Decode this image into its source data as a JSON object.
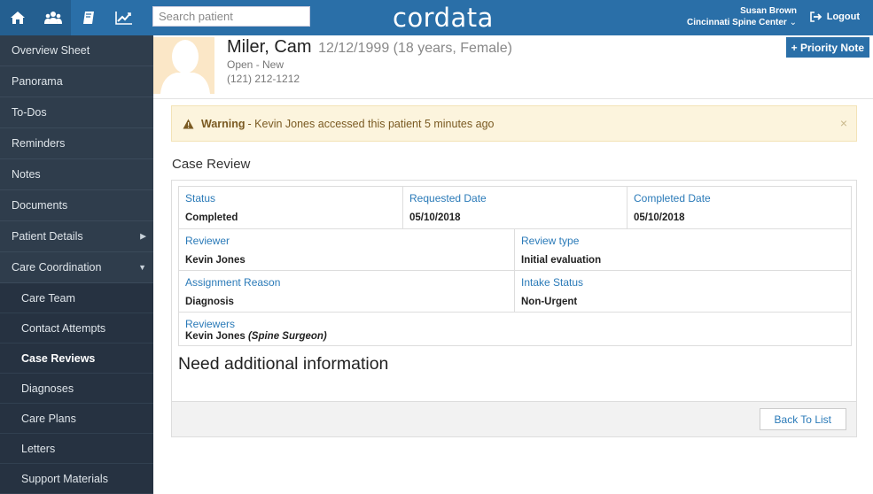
{
  "topbar": {
    "nav_icons": [
      "home-icon",
      "team-icon",
      "book-icon",
      "chart-icon"
    ],
    "search_placeholder": "Search patient",
    "brand": "cordata",
    "user_name": "Susan Brown",
    "org_name": "Cincinnati Spine Center",
    "logout_label": "Logout"
  },
  "sidebar": {
    "items": [
      {
        "label": "Overview Sheet"
      },
      {
        "label": "Panorama"
      },
      {
        "label": "To-Dos"
      },
      {
        "label": "Reminders"
      },
      {
        "label": "Notes"
      },
      {
        "label": "Documents"
      },
      {
        "label": "Patient Details"
      },
      {
        "label": "Care Coordination"
      }
    ],
    "sub_items": [
      {
        "label": "Care Team"
      },
      {
        "label": "Contact Attempts"
      },
      {
        "label": "Case Reviews"
      },
      {
        "label": "Diagnoses"
      },
      {
        "label": "Care Plans"
      },
      {
        "label": "Letters"
      },
      {
        "label": "Support Materials"
      }
    ]
  },
  "patient": {
    "name": "Miler, Cam",
    "dob_info": "12/12/1999 (18 years, Female)",
    "status": "Open - New",
    "phone": "(121) 212-1212",
    "priority_note_label": "+ Priority Note"
  },
  "warning": {
    "title": "Warning",
    "message": "- Kevin Jones accessed this patient 5 minutes ago"
  },
  "case_review": {
    "title": "Case Review",
    "status_label": "Status",
    "status_value": "Completed",
    "requested_label": "Requested Date",
    "requested_value": "05/10/2018",
    "completed_label": "Completed Date",
    "completed_value": "05/10/2018",
    "reviewer_label": "Reviewer",
    "reviewer_value": "Kevin Jones",
    "review_type_label": "Review type",
    "review_type_value": "Initial evaluation",
    "assignment_label": "Assignment Reason",
    "assignment_value": "Diagnosis",
    "intake_label": "Intake Status",
    "intake_value": "Non-Urgent",
    "reviewers_label": "Reviewers",
    "reviewers_name": "Kevin Jones",
    "reviewers_role": "(Spine Surgeon)",
    "need_info": "Need additional information",
    "back_label": "Back To List"
  },
  "colors": {
    "topbar": "#2a6fa8",
    "sidebar": "#2f3d4c",
    "link": "#2a7ab8",
    "warning_bg": "#fcf4dd"
  }
}
